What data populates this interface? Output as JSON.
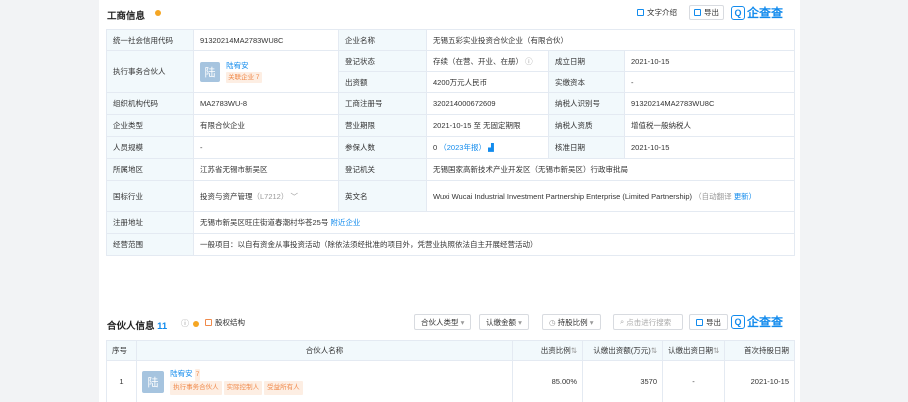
{
  "section1": {
    "title": "工商信息",
    "text_intro": "文字介绍",
    "export": "导出",
    "brand": "企查查"
  },
  "info": {
    "credit_code_label": "统一社会信用代码",
    "credit_code": "91320214MA2783WU8C",
    "company_name_label": "企业名称",
    "company_name": "无锡五彩实业投资合伙企业（有限合伙）",
    "partner_exec_label": "执行事务合伙人",
    "partner_avatar": "陆",
    "partner_name": "陆宥安",
    "partner_related": "关联企业 7",
    "reg_status_label": "登记状态",
    "reg_status": "存续（在营、开业、在册）",
    "est_date_label": "成立日期",
    "est_date": "2021-10-15",
    "capital_label": "出资额",
    "capital": "4200万元人民币",
    "paid_label": "实缴资本",
    "paid": "-",
    "org_code_label": "组织机构代码",
    "org_code": "MA2783WU-8",
    "reg_no_label": "工商注册号",
    "reg_no": "320214000672609",
    "taxpayer_id_label": "纳税人识别号",
    "taxpayer_id": "91320214MA2783WU8C",
    "company_type_label": "企业类型",
    "company_type": "有限合伙企业",
    "term_label": "营业期限",
    "term": "2021-10-15 至 无固定期限",
    "taxpayer_qual_label": "纳税人资质",
    "taxpayer_qual": "增值税一般纳税人",
    "staff_label": "人员规模",
    "staff": "-",
    "insured_label": "参保人数",
    "insured_count": "0",
    "insured_year": "（2023年报）",
    "approve_date_label": "核准日期",
    "approve_date": "2021-10-15",
    "region_label": "所属地区",
    "region": "江苏省无锡市新吴区",
    "authority_label": "登记机关",
    "authority": "无锡国家高新技术产业开发区（无锡市新吴区）行政审批局",
    "industry_label": "国标行业",
    "industry": "投资与资产管理",
    "industry_code": "（L7212）",
    "english_label": "英文名",
    "english_line1": "Wuxi Wucai Industrial Investment Partnership Enterprise (Limited Partnership)",
    "english_auto": "（自动翻译",
    "english_line2": "更新）",
    "address_label": "注册地址",
    "address": "无锡市新吴区旺庄街道春潮村华苍25号",
    "address_nearby": "附近企业",
    "scope_label": "经营范围",
    "scope": "一般项目：以自有资金从事投资活动（除依法须经批准的项目外，凭营业执照依法自主开展经营活动）"
  },
  "section2": {
    "title": "合伙人信息",
    "count": "11",
    "equity_structure": "股权结构",
    "filters": [
      "合伙人类型",
      "认缴金额",
      "持股比例"
    ],
    "search_placeholder": "点击进行搜索",
    "export": "导出",
    "brand": "企查查"
  },
  "partners": {
    "headers": [
      "序号",
      "合伙人名称",
      "出资比例",
      "认缴出资额(万元)",
      "认缴出资日期",
      "首次持股日期"
    ],
    "rows": [
      {
        "index": "1",
        "avatar": "陆",
        "name": "陆宥安",
        "related": "7",
        "tags": [
          "执行事务合伙人",
          "实际控制人",
          "受益所有人"
        ],
        "ratio": "85.00%",
        "amount": "3570",
        "sub_date": "-",
        "first_date": "2021-10-15"
      }
    ]
  },
  "colors": {
    "accent": "#128bed",
    "label_bg": "#f2f9fc",
    "tag_orange": "#f08a4b"
  }
}
